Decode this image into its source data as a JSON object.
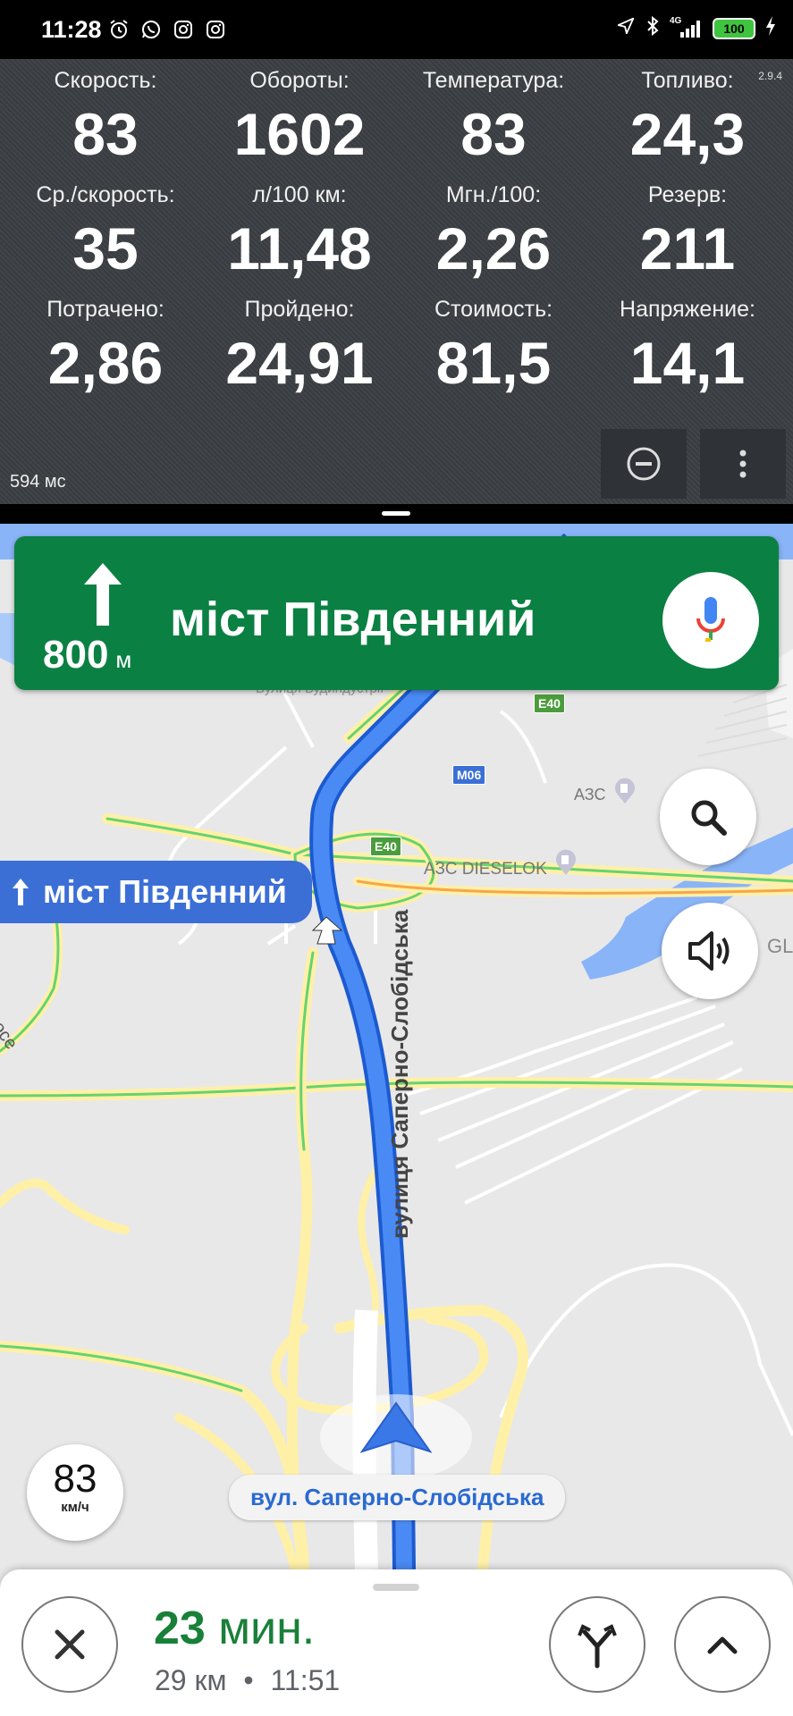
{
  "status_bar": {
    "time": "11:28",
    "left_icons": [
      "alarm-icon",
      "whatsapp-icon",
      "instagram-icon",
      "instagram-icon"
    ],
    "right_icons": [
      "location-icon",
      "bluetooth-icon",
      "signal-4g-icon",
      "battery-icon",
      "charging-icon"
    ],
    "network": "4G",
    "battery": "100"
  },
  "dashboard": {
    "version": "2.9.4",
    "cells": [
      {
        "label": "Скорость:",
        "value": "83"
      },
      {
        "label": "Обороты:",
        "value": "1602"
      },
      {
        "label": "Температура:",
        "value": "83"
      },
      {
        "label": "Топливо:",
        "value": "24,3"
      },
      {
        "label": "Ср./скорость:",
        "value": "35"
      },
      {
        "label": "л/100 км:",
        "value": "11,48"
      },
      {
        "label": "Мгн./100:",
        "value": "2,26"
      },
      {
        "label": "Резерв:",
        "value": "211"
      },
      {
        "label": "Потрачено:",
        "value": "2,86"
      },
      {
        "label": "Пройдено:",
        "value": "24,91"
      },
      {
        "label": "Стоимость:",
        "value": "81,5"
      },
      {
        "label": "Напряжение:",
        "value": "14,1"
      }
    ],
    "latency": "594 мс",
    "buttons": [
      "minus-circle-icon",
      "more-vert-icon"
    ]
  },
  "navigation": {
    "distance": "800",
    "distance_unit": "м",
    "street": "міст Південний",
    "chip_label": "міст Південний",
    "current_street": "вул. Саперно-Слобідська",
    "colors": {
      "banner": "#0b8043",
      "route": "#3b78e7",
      "eta": "#188038"
    }
  },
  "map": {
    "poi_1": "АЗС",
    "poi_2": "АЗС DIESELOK",
    "shield_e40_top": "E40",
    "shield_m06": "M06",
    "shield_e40_mid": "E40",
    "partial_labels": [
      "GL",
      "шосе",
      "Вулиця Будиндустрії"
    ],
    "road_vertical": "вулиця Саперно-Слобідська"
  },
  "speed": {
    "value": "83",
    "unit": "км/ч"
  },
  "trip": {
    "eta_value": "23",
    "eta_unit": "мин.",
    "distance": "29 км",
    "separator": "•",
    "arrival": "11:51"
  }
}
